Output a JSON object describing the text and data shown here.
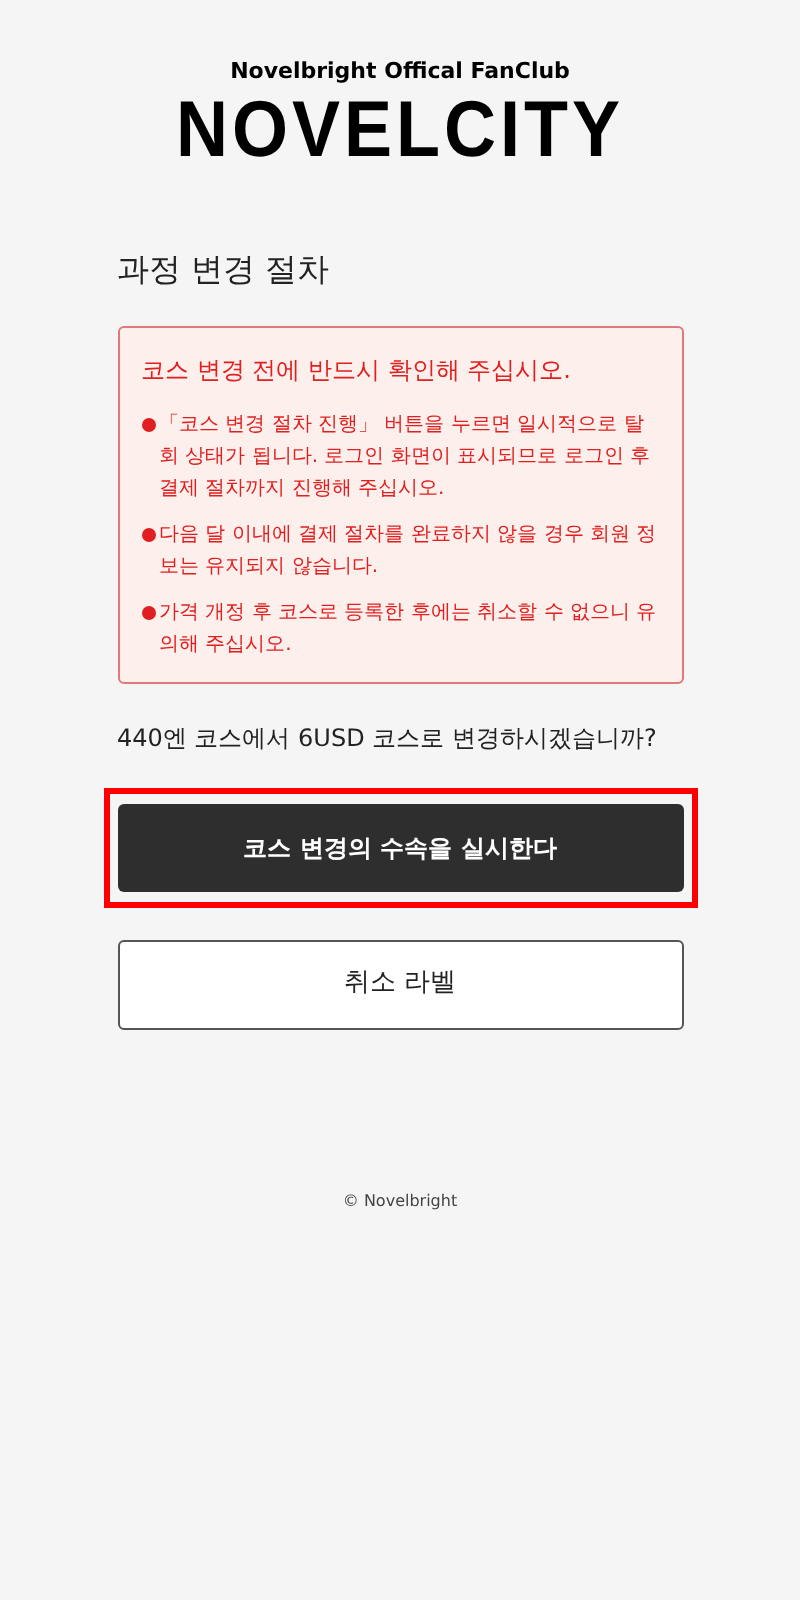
{
  "header": {
    "tagline": "Novelbright Offical FanClub",
    "logo": "NOVELCITY"
  },
  "title": "과정 변경 절차",
  "notice": {
    "heading": "코스 변경 전에 반드시 확인해 주십시오.",
    "items": [
      "「코스 변경 절차 진행」 버튼을 누르면 일시적으로 탈회 상태가 됩니다. 로그인 화면이 표시되므로 로그인 후 결제 절차까지 진행해 주십시오.",
      "다음 달 이내에 결제 절차를 완료하지 않을 경우 회원 정보는 유지되지 않습니다.",
      "가격 개정 후 코스로 등록한 후에는 취소할 수 없으니 유의해 주십시오."
    ]
  },
  "question": "440엔 코스에서 6USD 코스로 변경하시겠습니까?",
  "buttons": [
    {
      "label": "코스 변경의 수속을 실시한다",
      "kind": "primary",
      "highlighted": true
    },
    {
      "label": "취소 라벨",
      "kind": "secondary",
      "highlighted": false
    }
  ],
  "footer": "© Novelbright"
}
